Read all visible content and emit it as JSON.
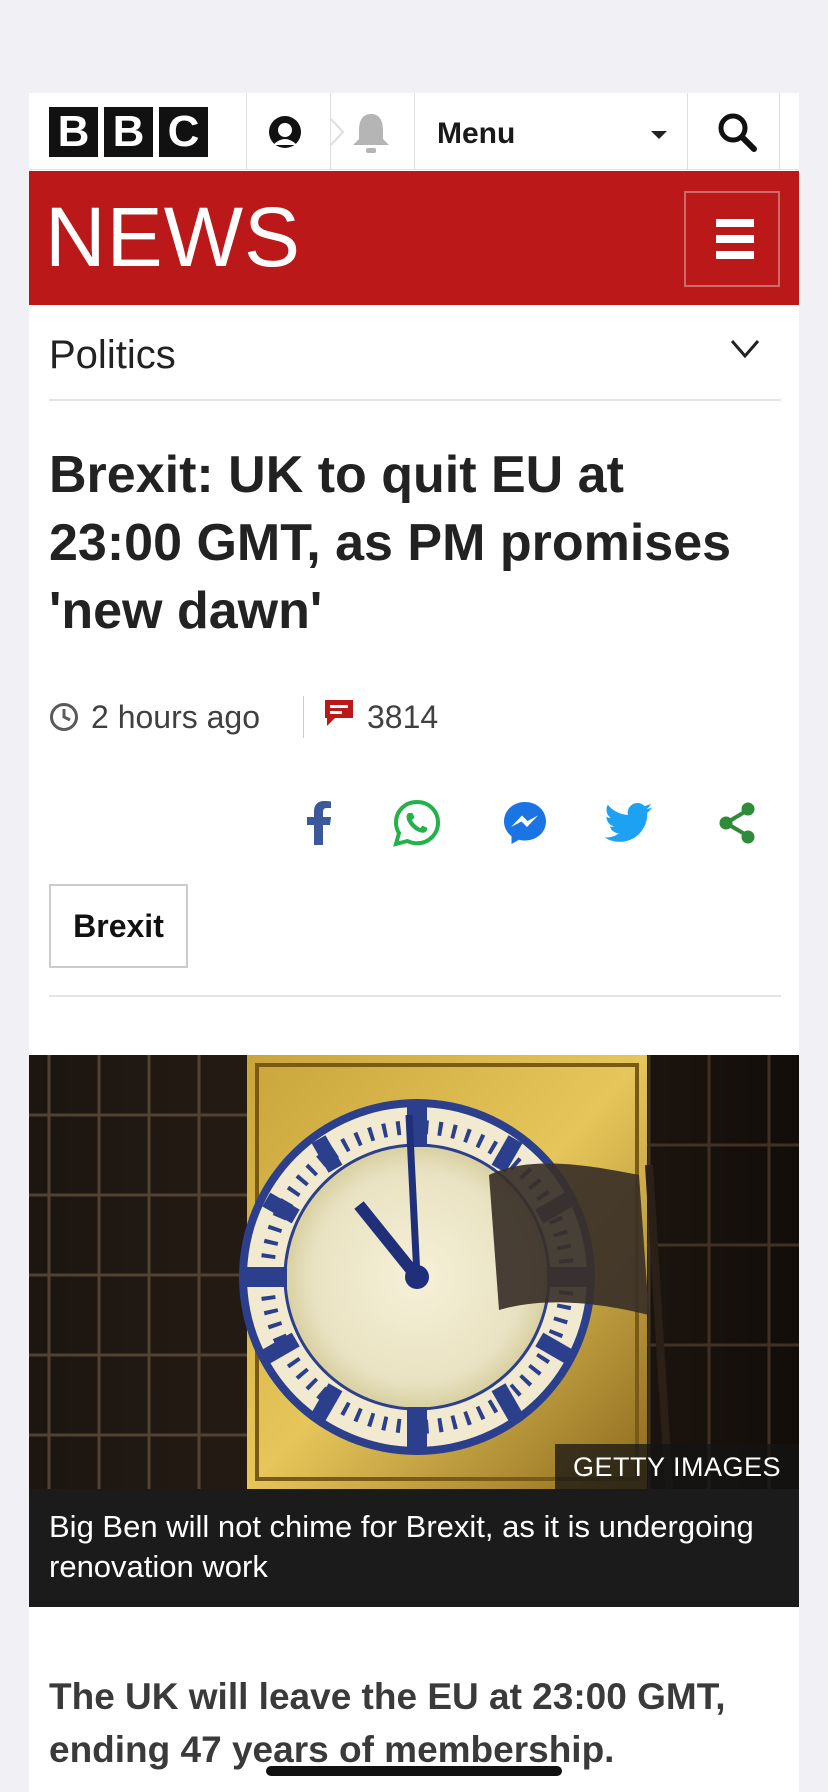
{
  "brand": {
    "bbc_letters": [
      "B",
      "B",
      "C"
    ],
    "news_title": "NEWS"
  },
  "topbar": {
    "menu_label": "Menu",
    "icons": [
      "account-icon",
      "notification-bell-icon",
      "search-icon"
    ]
  },
  "section": {
    "label": "Politics"
  },
  "article": {
    "headline": "Brexit: UK to quit EU at 23:00 GMT, as PM promises 'new dawn'",
    "timestamp": "2 hours ago",
    "comment_count": "3814",
    "tag": "Brexit",
    "image_credit": "GETTY IMAGES",
    "image_caption": "Big Ben will not chime for Brexit, as it is undergoing renovation work",
    "intro": "The UK will leave the EU at 23:00 GMT, ending 47 years of membership."
  },
  "share": {
    "items": [
      "facebook",
      "whatsapp",
      "messenger",
      "twitter",
      "share"
    ]
  },
  "colors": {
    "news_red": "#bb1919",
    "facebook": "#3b5998",
    "whatsapp": "#25b14a",
    "messenger": "#1b74e4",
    "twitter": "#1da1f2",
    "share_green": "#2e8b3a"
  }
}
